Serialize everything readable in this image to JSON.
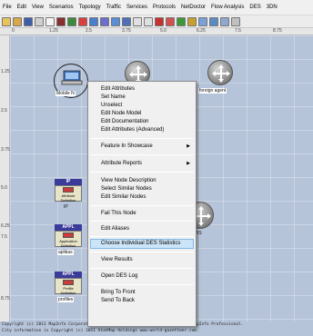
{
  "menu": [
    "File",
    "Edit",
    "View",
    "Scenarios",
    "Topology",
    "Traffic",
    "Services",
    "Protocols",
    "NetDoctor",
    "Flow Analysis",
    "DES",
    "3DN"
  ],
  "ruler_top": [
    "0",
    "1.25",
    "2.5",
    "3.75",
    "5.0",
    "6.25",
    "7.5",
    "8.75"
  ],
  "ruler_left": [
    "1.25",
    "2.5",
    "3.75",
    "5.0",
    "6.25",
    "7.5",
    "8.75"
  ],
  "nodes": {
    "mobile": "Mobile N",
    "foreign_agent": "foreign agent",
    "ip_config": {
      "header": "IP",
      "body": "Attribute Definition",
      "label": "IP"
    },
    "app_config": {
      "header": "APPL",
      "body": "Application Definition",
      "label": "aplikas"
    },
    "profile_config": {
      "header": "APPL",
      "body": "Profile Definition",
      "label": "profiles"
    },
    "router_bs": "BS",
    "server": "CN"
  },
  "context_menu": {
    "group1": [
      "Edit Attributes",
      "Set Name",
      "Unselect",
      "Edit Node Model",
      "Edit Documentation",
      "Edit Attributes (Advanced)"
    ],
    "feature_showcase": "Feature In Showcase",
    "attribute_reports": "Attribute Reports",
    "group2": [
      "View Node Description",
      "Select Similar Nodes",
      "Edit Similar Nodes"
    ],
    "fail": "Fail This Node",
    "aliases": "Edit Aliases",
    "des_stats": "Choose Individual DES Statistics",
    "view_results": "View Results",
    "open_log": "Open DES Log",
    "bring_front": "Bring To Front",
    "send_back": "Send To Back"
  },
  "copyright": [
    "Copyright (c) 2011 MapInfo Corporation, Troy, New York. Image rendered using MapInfo Professional.",
    "City information is Copyright (c) 2011 StatMap Holdings www.world-gazetteer.com."
  ]
}
